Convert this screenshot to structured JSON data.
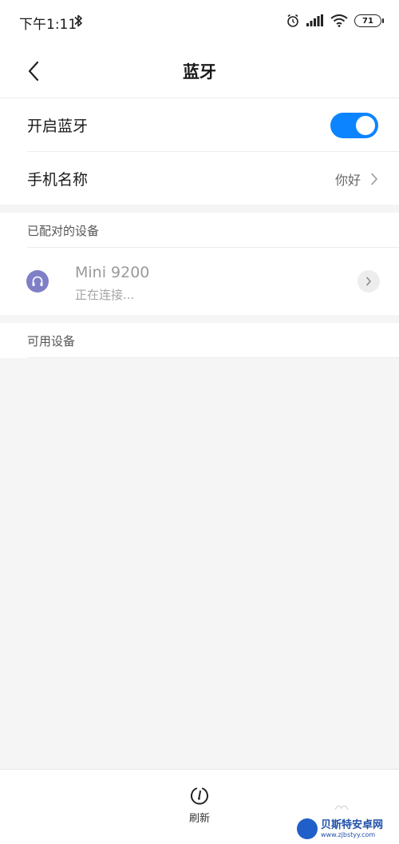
{
  "status_bar": {
    "time": "下午1:11",
    "battery": "71",
    "icons": [
      "bluetooth-icon",
      "alarm-icon",
      "signal-icon",
      "wifi-icon",
      "battery-icon"
    ]
  },
  "nav": {
    "title": "蓝牙",
    "back_icon": "chevron-left-icon"
  },
  "settings": {
    "bluetooth_toggle_label": "开启蓝牙",
    "bluetooth_on": true,
    "phone_name_label": "手机名称",
    "phone_name_value": "你好"
  },
  "paired": {
    "header": "已配对的设备",
    "devices": [
      {
        "name": "Mini 9200",
        "status": "正在连接...",
        "icon": "headphones-icon"
      }
    ]
  },
  "available": {
    "header": "可用设备"
  },
  "bottom": {
    "refresh_label": "刷新",
    "refresh_icon": "refresh-icon"
  },
  "watermark": {
    "title": "贝斯特安卓网",
    "url": "www.zjbstyy.com"
  },
  "colors": {
    "accent": "#0d84ff",
    "device_icon": "#7f7fc8",
    "background": "#f5f5f5"
  }
}
